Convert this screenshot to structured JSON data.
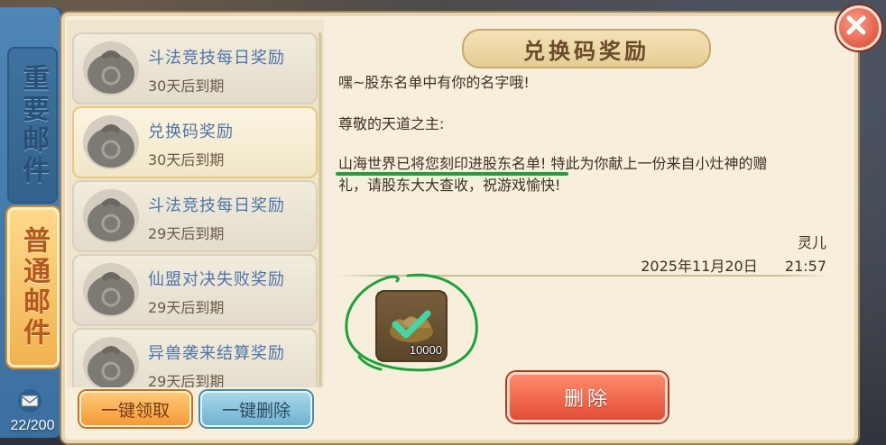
{
  "sidebar": {
    "tabs": [
      {
        "label": "重要邮件",
        "selected": false
      },
      {
        "label": "普通邮件",
        "selected": true
      }
    ],
    "mail_count": "22/200"
  },
  "mail_list": {
    "items": [
      {
        "title": "斗法竞技每日奖励",
        "expire": "30天后到期",
        "selected": false
      },
      {
        "title": "兑换码奖励",
        "expire": "30天后到期",
        "selected": true
      },
      {
        "title": "斗法竞技每日奖励",
        "expire": "29天后到期",
        "selected": false
      },
      {
        "title": "仙盟对决失败奖励",
        "expire": "29天后到期",
        "selected": false
      },
      {
        "title": "异兽袭来结算奖励",
        "expire": "29天后到期",
        "selected": false
      }
    ],
    "claim_all_label": "一键领取",
    "delete_all_label": "一键删除"
  },
  "detail": {
    "title": "兑换码奖励",
    "greeting": "嘿~股东名单中有你的名字哦!",
    "salutation": "尊敬的天道之主:",
    "paragraph_line1": "山海世界已将您刻印进股东名单! 特此为你献上一份来自小灶神的赠",
    "paragraph_line2": "礼，请股东大大查收，祝游戏愉快!",
    "sender": "灵儿",
    "date": "2025年11月20日",
    "time": "21:57",
    "reward": {
      "icon": "gold-ingot-icon",
      "quantity": "10000",
      "claimed": true
    },
    "delete_label": "删除"
  },
  "colors": {
    "accent_orange": "#f39a35",
    "rail_blue": "#3b6f9f",
    "delete_red": "#e34d37",
    "annotation_green": "#1aa33a"
  }
}
